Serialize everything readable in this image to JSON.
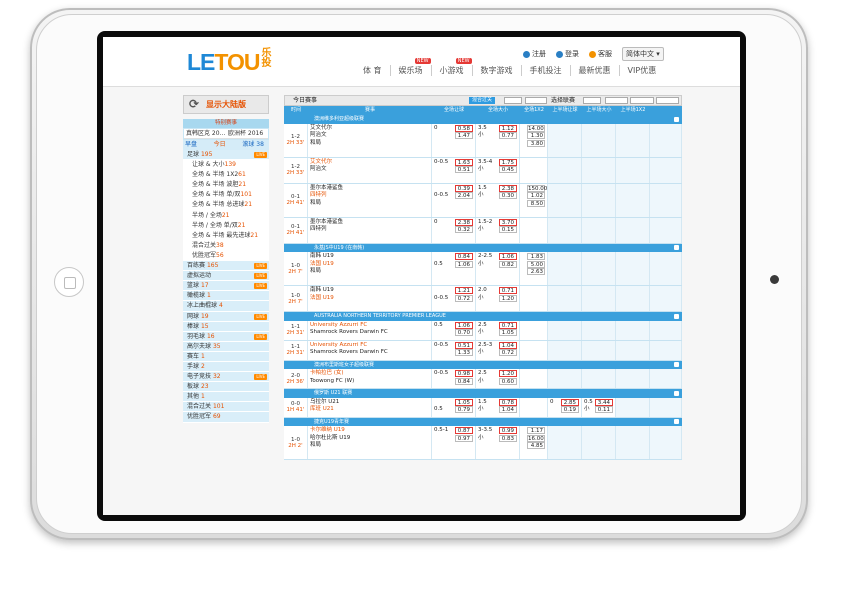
{
  "brand": {
    "le": "LE",
    "tou": "TOU",
    "cn": "乐投"
  },
  "toplinks": {
    "register": "注册",
    "login": "登录",
    "service": "客服",
    "lang": "简体中文 ▾"
  },
  "nav": [
    {
      "label": "体 育",
      "new": ""
    },
    {
      "label": "娱乐场",
      "new": "NEW"
    },
    {
      "label": "小游戏",
      "new": "NEW"
    },
    {
      "label": "数字游戏",
      "new": ""
    },
    {
      "label": "手机投注",
      "new": ""
    },
    {
      "label": "最新优惠",
      "new": ""
    },
    {
      "label": "VIP优惠",
      "new": ""
    }
  ],
  "sidebar": {
    "show_label": "显示大陆版",
    "head": "特别赛事",
    "special": [
      "真韩区克 20...",
      "欧洲杯 2016"
    ],
    "tabs": [
      {
        "label": "早盘",
        "active": false
      },
      {
        "label": "今日",
        "active": true
      },
      {
        "label": "滚球 38",
        "active": false
      }
    ],
    "football": {
      "label": "足球",
      "count": "195",
      "live": "LIVE"
    },
    "subs": [
      {
        "label": "让球 & 大小",
        "count": "139"
      },
      {
        "label": "全场 & 半场 1X2",
        "count": "61"
      },
      {
        "label": "全场 & 半场 波胆",
        "count": "21"
      },
      {
        "label": "全场 & 半场 单/双",
        "count": "101"
      },
      {
        "label": "全场 & 半场 总进球",
        "count": "21"
      },
      {
        "label": "半场 / 全场",
        "count": "21"
      },
      {
        "label": "半场 / 全场 单/双",
        "count": "21"
      },
      {
        "label": "全场 & 半场 最先进球",
        "count": "21"
      },
      {
        "label": "混合过关",
        "count": "38"
      },
      {
        "label": "优胜冠军",
        "count": "56"
      }
    ],
    "sports": [
      {
        "label": "百练赛",
        "count": "165",
        "live": "LIVE"
      },
      {
        "label": "虚拟运动",
        "count": "",
        "live": "LIVE"
      },
      {
        "label": "篮球",
        "count": "17",
        "live": "LIVE"
      },
      {
        "label": "橄榄球",
        "count": "1",
        "live": ""
      },
      {
        "label": "冰上曲棍球",
        "count": "4",
        "live": ""
      },
      {
        "label": "网球",
        "count": "19",
        "live": "LIVE"
      },
      {
        "label": "棒球",
        "count": "15",
        "live": ""
      },
      {
        "label": "羽毛球",
        "count": "16",
        "live": "LIVE"
      },
      {
        "label": "高尔夫球",
        "count": "35",
        "live": ""
      },
      {
        "label": "赛车",
        "count": "1",
        "live": ""
      },
      {
        "label": "手球",
        "count": "2",
        "live": ""
      },
      {
        "label": "电子竞技",
        "count": "32",
        "live": "LIVE"
      },
      {
        "label": "板球",
        "count": "23",
        "live": ""
      },
      {
        "label": "其他",
        "count": "1",
        "live": ""
      },
      {
        "label": "混合过关",
        "count": "101",
        "live": ""
      },
      {
        "label": "优胜冠军",
        "count": "69",
        "live": ""
      }
    ]
  },
  "main": {
    "bar_title": "今日赛事",
    "mix_btn": "混合过关",
    "select_label": "选择联赛",
    "columns": [
      "时间",
      "赛事",
      "全场让球",
      "全场大小",
      "全场1X2",
      "上半场让球",
      "上半场大小",
      "上半场1X2",
      ""
    ],
    "sections": [
      {
        "league": "澳洲维多利亚超级联赛",
        "matches": [
          {
            "score": "1-2",
            "time": "2H 33'",
            "teams": [
              "艾文代尔",
              "阿治文",
              "和局"
            ],
            "red": [],
            "hcap": [
              [
                "0",
                "0.58"
              ],
              [
                "",
                "1.47"
              ]
            ],
            "ou": [
              [
                "3.5",
                "1.12"
              ],
              [
                "小",
                "0.77"
              ]
            ],
            "x12": [
              "14.00",
              "1.30",
              "3.80"
            ],
            "size": "c1"
          },
          {
            "score": "1-2",
            "time": "2H 33'",
            "teams": [
              "艾文代尔",
              "阿治文"
            ],
            "red": [
              0
            ],
            "hcap": [
              [
                "0-0.5",
                "1.63"
              ],
              [
                "",
                "0.51"
              ]
            ],
            "ou": [
              [
                "3.5-4",
                "1.75"
              ],
              [
                "小",
                "0.45"
              ]
            ],
            "x12": [],
            "size": "c2"
          },
          {
            "score": "0-1",
            "time": "2H 41'",
            "teams": [
              "墨尔本港鲨鱼",
              "四特列",
              "和局"
            ],
            "red": [
              1
            ],
            "hcap": [
              [
                "",
                "0.39"
              ],
              [
                "0-0.5",
                "2.04"
              ]
            ],
            "ou": [
              [
                "1.5",
                "2.38"
              ],
              [
                "小",
                "0.30"
              ]
            ],
            "x12": [
              "150.00",
              "1.02",
              "8.50"
            ],
            "size": "c1"
          },
          {
            "score": "0-1",
            "time": "2H 41'",
            "teams": [
              "墨尔本港鲨鱼",
              "四特列"
            ],
            "red": [],
            "hcap": [
              [
                "0",
                "2.38"
              ],
              [
                "",
                "0.32"
              ]
            ],
            "ou": [
              [
                "1.5-2",
                "3.70"
              ],
              [
                "小",
                "0.15"
              ]
            ],
            "x12": [],
            "size": "c2"
          }
        ]
      },
      {
        "league": "永基JS中U19 (在南韩)",
        "matches": [
          {
            "score": "1-0",
            "time": "2H 7'",
            "teams": [
              "南韩 U19",
              "法国 U19",
              "和局"
            ],
            "red": [
              1
            ],
            "hcap": [
              [
                "",
                "0.84"
              ],
              [
                "0.5",
                "1.06"
              ]
            ],
            "ou": [
              [
                "2-2.5",
                "1.06"
              ],
              [
                "小",
                "0.82"
              ]
            ],
            "x12": [
              "1.83",
              "5.00",
              "2.63"
            ],
            "size": "c1"
          },
          {
            "score": "1-0",
            "time": "2H 7'",
            "teams": [
              "南韩 U19",
              "法国 U19"
            ],
            "red": [
              1
            ],
            "hcap": [
              [
                "",
                "1.21"
              ],
              [
                "0-0.5",
                "0.72"
              ]
            ],
            "ou": [
              [
                "2.0",
                "0.71"
              ],
              [
                "小",
                "1.20"
              ]
            ],
            "x12": [],
            "size": "c2"
          }
        ]
      },
      {
        "league": "AUSTRALIA NORTHERN TERRITORY PREMIER LEAGUE",
        "matches": [
          {
            "score": "1-1",
            "time": "2H 31'",
            "teams": [
              "University Azzurri FC",
              "Shamrock Rovers Darwin FC"
            ],
            "red": [
              0
            ],
            "hcap": [
              [
                "0.5",
                "1.06"
              ],
              [
                "",
                "0.70"
              ]
            ],
            "ou": [
              [
                "2.5",
                "0.71"
              ],
              [
                "小",
                "1.05"
              ]
            ],
            "x12": [],
            "size": "c3"
          },
          {
            "score": "1-1",
            "time": "2H 31'",
            "teams": [
              "University Azzurri FC",
              "Shamrock Rovers Darwin FC"
            ],
            "red": [
              0
            ],
            "hcap": [
              [
                "0-0.5",
                "0.51"
              ],
              [
                "",
                "1.33"
              ]
            ],
            "ou": [
              [
                "2.5-3",
                "1.04"
              ],
              [
                "小",
                "0.72"
              ]
            ],
            "x12": [],
            "size": "c3"
          }
        ]
      },
      {
        "league": "澳洲布里斯班女子超级联赛",
        "matches": [
          {
            "score": "2-0",
            "time": "2H 36'",
            "teams": [
              "卡帕拉巴 (女)",
              "Toowong FC (W)"
            ],
            "red": [
              0
            ],
            "hcap": [
              [
                "0-0.5",
                "0.98"
              ],
              [
                "",
                "0.84"
              ]
            ],
            "ou": [
              [
                "2.5",
                "1.20"
              ],
              [
                "小",
                "0.60"
              ]
            ],
            "x12": [],
            "size": "c3"
          }
        ]
      },
      {
        "league": "俄罗斯 U21 联赛",
        "matches": [
          {
            "score": "0-0",
            "time": "1H 41'",
            "teams": [
              "乌拉尔 U21",
              "库班 U21"
            ],
            "red": [
              1
            ],
            "hcap": [
              [
                "",
                "1.05"
              ],
              [
                "0.5",
                "0.79"
              ]
            ],
            "ou": [
              [
                "1.5",
                "0.78"
              ],
              [
                "小",
                "1.04"
              ]
            ],
            "x12": [],
            "size": "c3",
            "h1": [
              [
                "0",
                "2.85"
              ],
              [
                "",
                "0.19"
              ]
            ],
            "h1ou": [
              [
                "0.5",
                "3.44"
              ],
              [
                "小",
                "0.11"
              ]
            ]
          }
        ]
      },
      {
        "league": "捷克U19青年赛",
        "matches": [
          {
            "score": "1-0",
            "time": "2H 2'",
            "teams": [
              "卡尔维纳 U19",
              "哈尔杜比斯 U19",
              "和局"
            ],
            "red": [
              0
            ],
            "hcap": [
              [
                "0.5-1",
                "0.87"
              ],
              [
                "",
                "0.97"
              ]
            ],
            "ou": [
              [
                "3-3.5",
                "0.99"
              ],
              [
                "小",
                "0.83"
              ]
            ],
            "x12": [
              "1.17",
              "16.00",
              "4.85"
            ],
            "size": "c1"
          }
        ]
      }
    ]
  }
}
